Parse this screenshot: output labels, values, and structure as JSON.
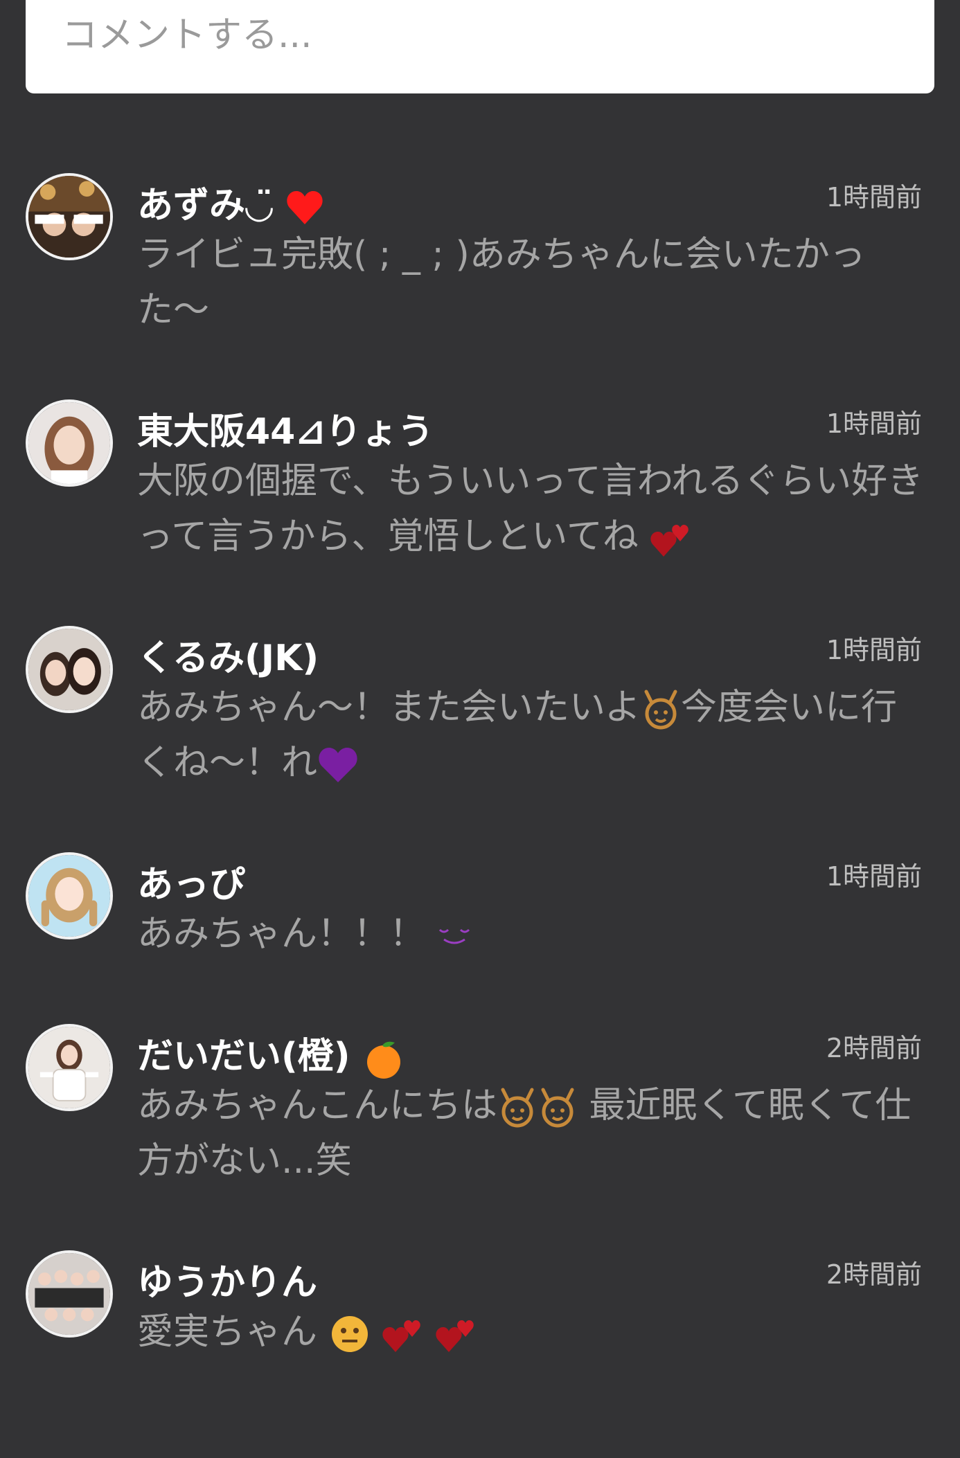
{
  "comment_input": {
    "placeholder": "コメントする..."
  },
  "comments": [
    {
      "name": "あずみ◡̈",
      "name_emoji": "red-heart-icon",
      "time": "1時間前",
      "text": "ライビュ完敗( ; _ ; )あみちゃんに会いたかった〜"
    },
    {
      "name": "東大阪44⊿りょう",
      "time": "1時間前",
      "text": "大阪の個握で、もういいって言われるぐらい好きって言うから、覚悟しといてね",
      "text_emoji": "two-hearts-icon"
    },
    {
      "name": "くるみ(JK)",
      "time": "1時間前",
      "text_parts": [
        "あみちゃん〜！また会いたいよ",
        "今度会いに行くね〜！れ"
      ],
      "text_emoji": [
        "raised-hands-icon",
        "purple-heart-icon"
      ]
    },
    {
      "name": "あっぴ",
      "time": "1時間前",
      "text": "あみちゃん！！！",
      "text_emoji": "smile-icon"
    },
    {
      "name": "だいだい(橙)",
      "name_emoji": "orange-icon",
      "time": "2時間前",
      "text_parts": [
        "あみちゃんこんにちは",
        " 最近眠くて眠くて仕方がない...笑"
      ],
      "text_emoji": [
        "raised-hands-icon",
        "raised-hands-icon"
      ]
    },
    {
      "name": "ゆうかりん",
      "time": "2時間前",
      "text": "愛実ちゃん",
      "text_emoji": [
        "neutral-face-icon",
        "two-hearts-icon",
        "two-hearts-icon"
      ]
    }
  ],
  "colors": {
    "background": "#333335",
    "name": "#ffffff",
    "text": "#a6a6a6",
    "time": "#bfbfbf",
    "heart_red": "#ff1a1a",
    "dark_red": "#b3141e",
    "purple": "#7a1fa2",
    "orange": "#ff8c1a",
    "gold": "#c78a3a"
  }
}
